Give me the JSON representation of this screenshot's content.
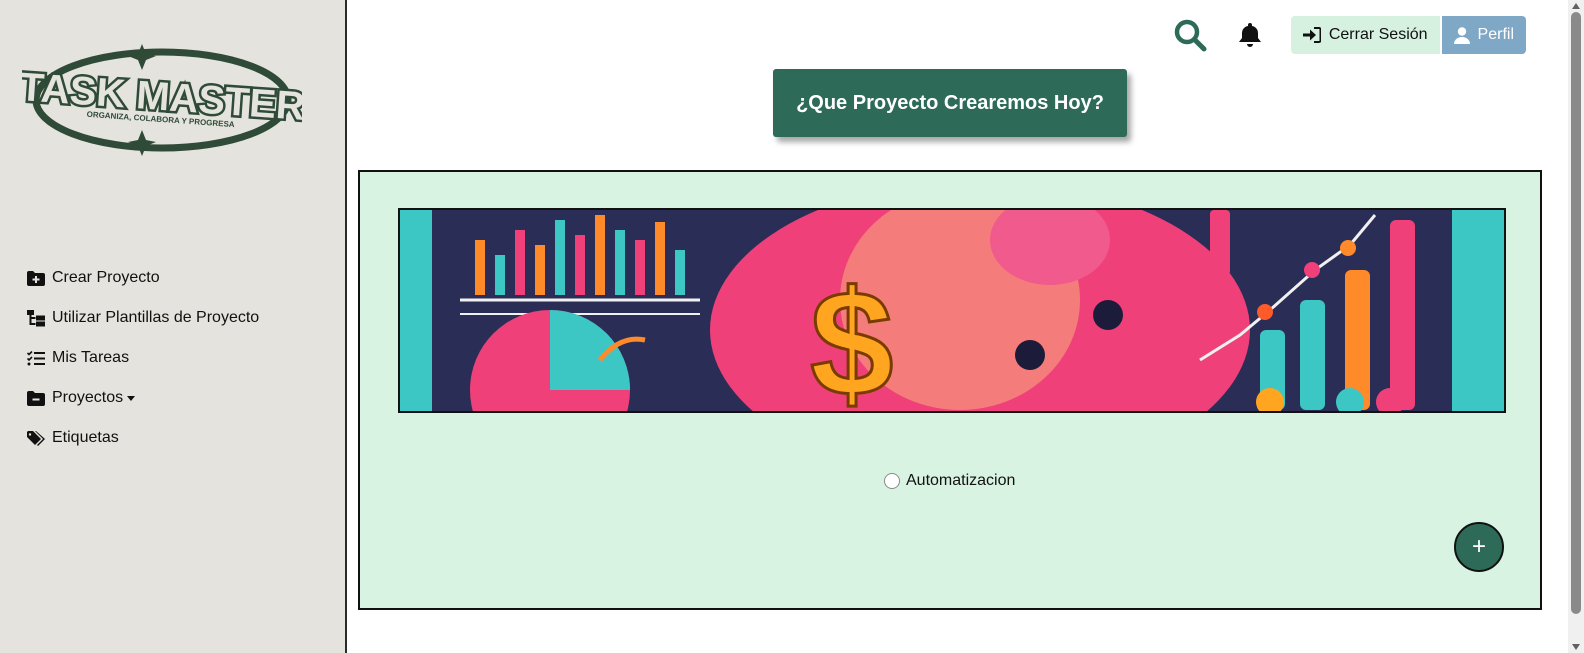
{
  "logo": {
    "title": "TASK MASTER",
    "tagline": "ORGANIZA, COLABORA Y PROGRESA"
  },
  "sidebar": {
    "items": [
      {
        "label": "Crear Proyecto",
        "icon": "folder-plus-icon"
      },
      {
        "label": "Utilizar Plantillas de Proyecto",
        "icon": "sitemap-icon"
      },
      {
        "label": "Mis Tareas",
        "icon": "list-check-icon"
      },
      {
        "label": "Proyectos",
        "icon": "folder-minus-icon",
        "dropdown": true
      },
      {
        "label": "Etiquetas",
        "icon": "tags-icon"
      }
    ]
  },
  "topbar": {
    "search_icon": "search-icon",
    "bell_icon": "bell-icon",
    "logout_label": "Cerrar Sesión",
    "profile_label": "Perfil"
  },
  "main": {
    "heading_button": "¿Que Proyecto Crearemos Hoy?",
    "option_label": "Automatizacion",
    "fab_label": "+"
  },
  "colors": {
    "sidebar_bg": "#e4e3de",
    "brand_green": "#2d6b58",
    "panel_bg": "#d9f3e2",
    "logout_bg": "#d7f1e1",
    "profile_bg": "#7fa7c6"
  }
}
